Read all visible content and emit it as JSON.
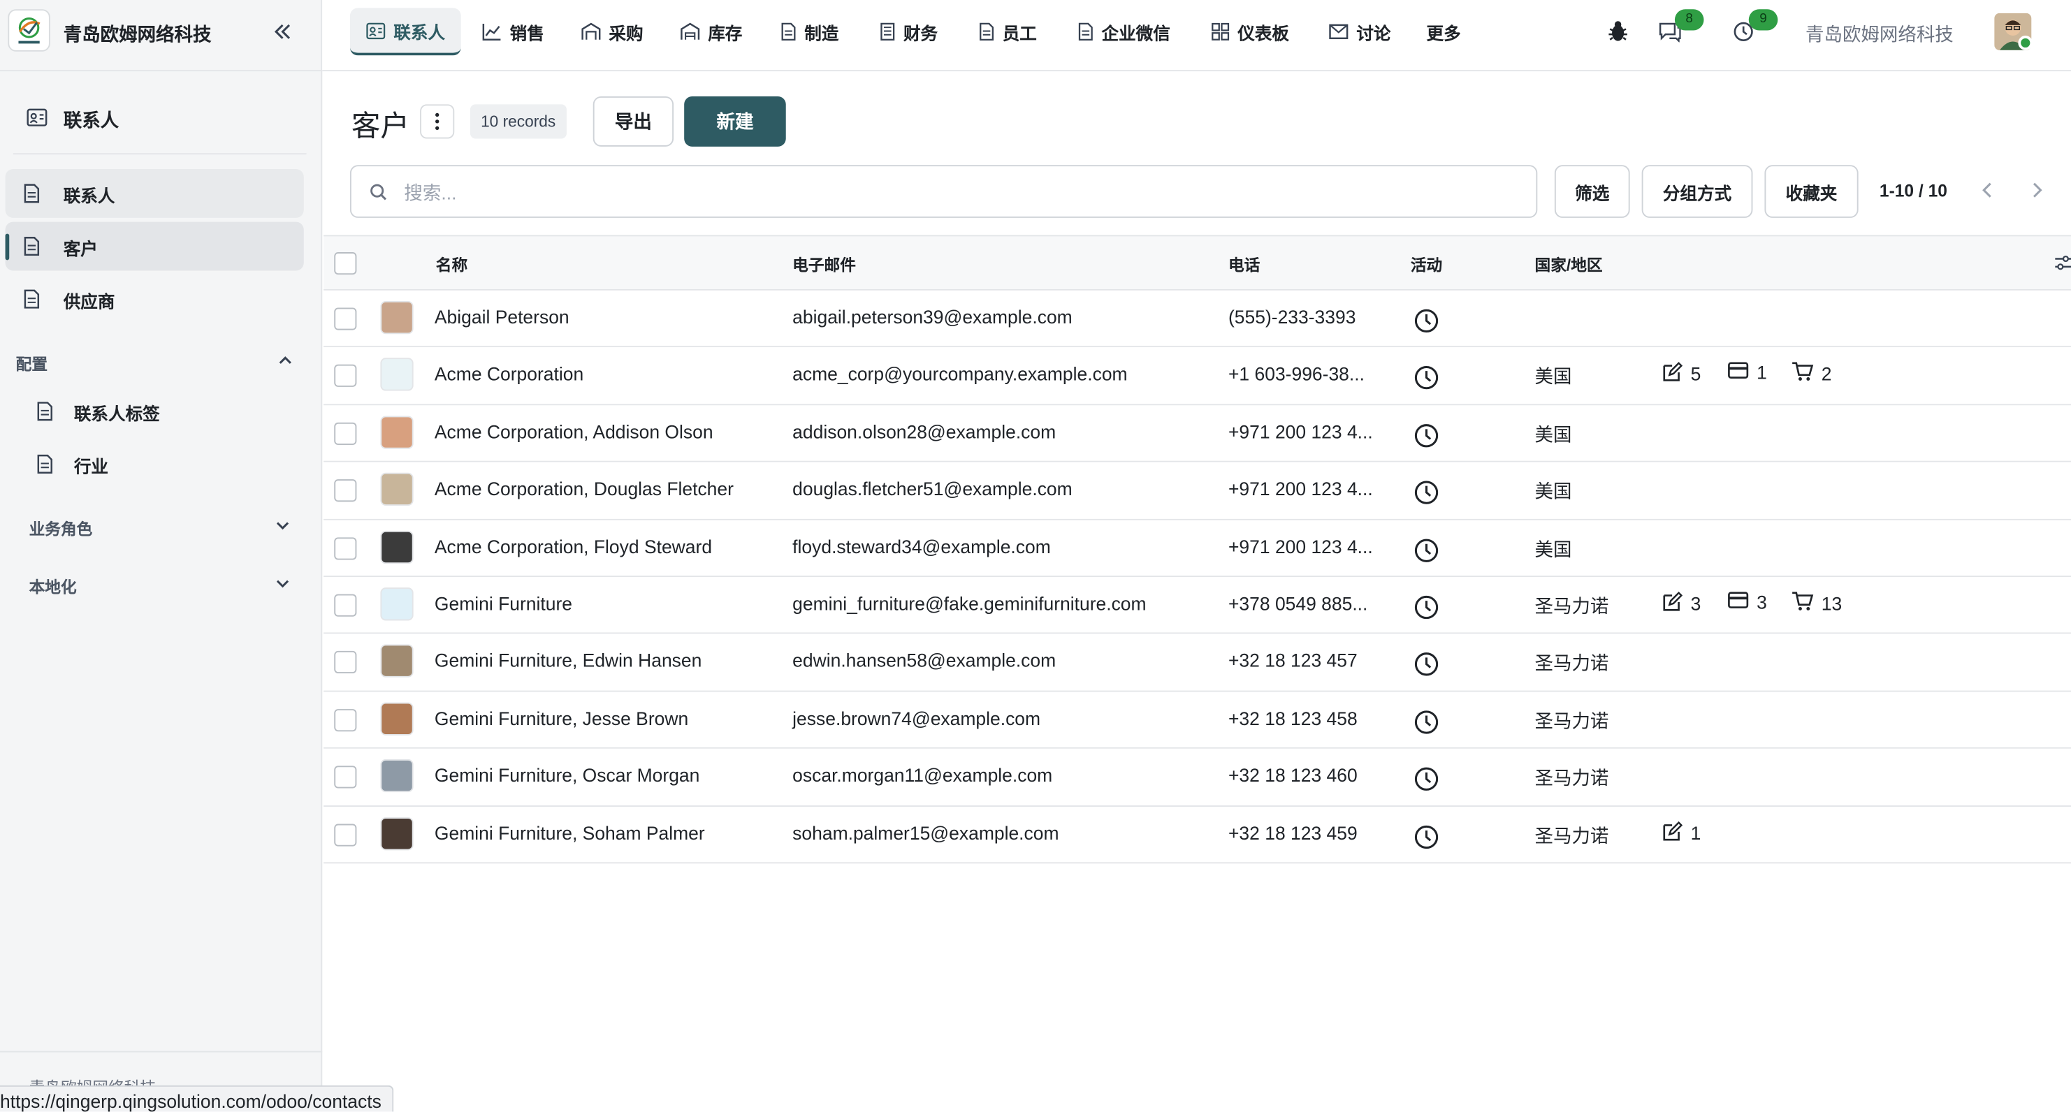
{
  "brand": {
    "name": "青岛欧姆网络科技",
    "logo_icon": "qingerp-logo-icon"
  },
  "sidebar": {
    "title": "联系人",
    "items": [
      {
        "label": "联系人",
        "state": "hover"
      },
      {
        "label": "客户",
        "state": "active"
      },
      {
        "label": "供应商",
        "state": "normal"
      }
    ],
    "config_section": "配置",
    "config_items": [
      {
        "label": "联系人标签"
      },
      {
        "label": "行业"
      }
    ],
    "sections": [
      {
        "label": "业务角色"
      },
      {
        "label": "本地化"
      }
    ],
    "footer": "青岛欧姆网络科技"
  },
  "status_url": "https://qingerp.qingsolution.com/odoo/contacts",
  "topnav": {
    "items": [
      {
        "label": "联系人",
        "icon": "contact-card-icon",
        "active": true
      },
      {
        "label": "销售",
        "icon": "line-chart-icon"
      },
      {
        "label": "采购",
        "icon": "store-icon"
      },
      {
        "label": "库存",
        "icon": "warehouse-icon"
      },
      {
        "label": "制造",
        "icon": "document-icon"
      },
      {
        "label": "财务",
        "icon": "ledger-icon"
      },
      {
        "label": "员工",
        "icon": "document-icon"
      },
      {
        "label": "企业微信",
        "icon": "document-icon"
      },
      {
        "label": "仪表板",
        "icon": "dashboard-icon"
      },
      {
        "label": "讨论",
        "icon": "mail-icon"
      }
    ],
    "more": "更多",
    "messages_badge": "8",
    "activities_badge": "9",
    "company": "青岛欧姆网络科技",
    "accent": "#2e5b63",
    "badge_color": "#2f9e44"
  },
  "control": {
    "page_title": "客户",
    "records": "10 records",
    "export_label": "导出",
    "new_label": "新建",
    "search_placeholder": "搜索...",
    "filter_label": "筛选",
    "groupby_label": "分组方式",
    "favorites_label": "收藏夹",
    "pager": "1-10 / 10"
  },
  "table": {
    "headers": {
      "name": "名称",
      "email": "电子邮件",
      "phone": "电话",
      "activity": "活动",
      "country": "国家/地区"
    },
    "rows": [
      {
        "name": "Abigail Peterson",
        "email": "abigail.peterson39@example.com",
        "phone": "(555)-233-3393",
        "country": "",
        "notes": "",
        "cards": "",
        "orders": ""
      },
      {
        "name": "Acme Corporation",
        "email": "acme_corp@yourcompany.example.com",
        "phone": "+1 603-996-38...",
        "country": "美国",
        "notes": "5",
        "cards": "1",
        "orders": "2"
      },
      {
        "name": "Acme Corporation, Addison Olson",
        "email": "addison.olson28@example.com",
        "phone": "+971 200 123 4...",
        "country": "美国",
        "notes": "",
        "cards": "",
        "orders": ""
      },
      {
        "name": "Acme Corporation, Douglas Fletcher",
        "email": "douglas.fletcher51@example.com",
        "phone": "+971 200 123 4...",
        "country": "美国",
        "notes": "",
        "cards": "",
        "orders": ""
      },
      {
        "name": "Acme Corporation, Floyd Steward",
        "email": "floyd.steward34@example.com",
        "phone": "+971 200 123 4...",
        "country": "美国",
        "notes": "",
        "cards": "",
        "orders": ""
      },
      {
        "name": "Gemini Furniture",
        "email": "gemini_furniture@fake.geminifurniture.com",
        "phone": "+378 0549 885...",
        "country": "圣马力诺",
        "notes": "3",
        "cards": "3",
        "orders": "13"
      },
      {
        "name": "Gemini Furniture, Edwin Hansen",
        "email": "edwin.hansen58@example.com",
        "phone": "+32 18 123 457",
        "country": "圣马力诺",
        "notes": "",
        "cards": "",
        "orders": ""
      },
      {
        "name": "Gemini Furniture, Jesse Brown",
        "email": "jesse.brown74@example.com",
        "phone": "+32 18 123 458",
        "country": "圣马力诺",
        "notes": "",
        "cards": "",
        "orders": ""
      },
      {
        "name": "Gemini Furniture, Oscar Morgan",
        "email": "oscar.morgan11@example.com",
        "phone": "+32 18 123 460",
        "country": "圣马力诺",
        "notes": "",
        "cards": "",
        "orders": ""
      },
      {
        "name": "Gemini Furniture, Soham Palmer",
        "email": "soham.palmer15@example.com",
        "phone": "+32 18 123 459",
        "country": "圣马力诺",
        "notes": "1",
        "cards": "",
        "orders": ""
      }
    ]
  }
}
